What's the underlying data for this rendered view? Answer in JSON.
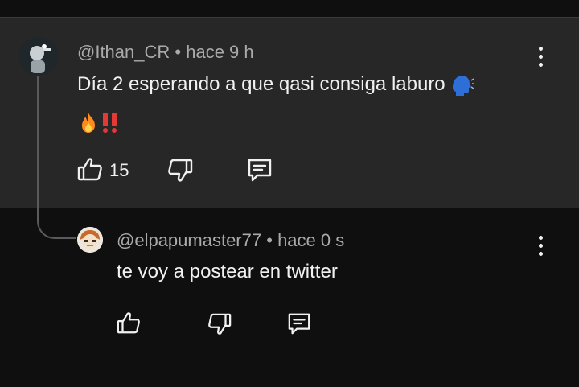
{
  "comment": {
    "username": "@Ithan_CR",
    "separator": "•",
    "time": "hace 9 h",
    "text": "Día 2 esperando a que qasi consiga laburo",
    "emojis": [
      "🗣️",
      "🔥",
      "‼️"
    ],
    "like_count": "15"
  },
  "reply": {
    "username": "@elpapumaster77",
    "separator": "•",
    "time": "hace 0 s",
    "text": "te voy a postear en twitter"
  },
  "colors": {
    "background": "#0f0f0f",
    "highlighted_comment": "#272727",
    "text_primary": "#f1f1f1",
    "text_secondary": "#aaaaaa",
    "emoji_speaking_head": "#2d6fd6",
    "emoji_fire": "#ff8a1e",
    "emoji_exclamation": "#e53935"
  },
  "icons": [
    "like-icon",
    "dislike-icon",
    "reply-icon",
    "more-vert-icon"
  ]
}
